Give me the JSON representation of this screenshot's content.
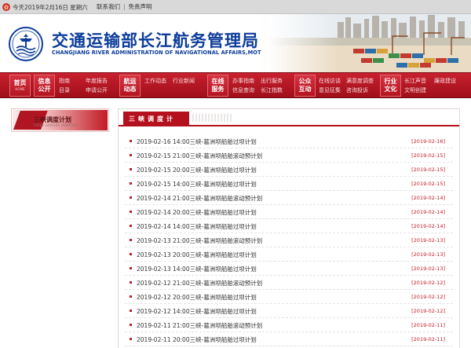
{
  "topbar": {
    "date": "今天2019年2月16日 星期六",
    "contact": "联系我们",
    "disclaimer": "免责声明"
  },
  "header": {
    "title": "交通运输部长江航务管理局",
    "subtitle": "CHANGJIANG RIVER ADMINISTRATION OF NAVIGATIONAL AFFAIRS,MOT"
  },
  "nav": {
    "home": {
      "label": "首页",
      "en": "HOME"
    },
    "groups": [
      {
        "main_line1": "信息",
        "main_line2": "公开",
        "subs": [
          "指南",
          "目录",
          "年度报告",
          "申请公开"
        ]
      },
      {
        "main_line1": "航运",
        "main_line2": "动态",
        "subs": [
          "工作动态",
          "行业新闻"
        ]
      },
      {
        "main_line1": "在线",
        "main_line2": "服务",
        "subs": [
          "办事指南",
          "信息查询",
          "出行服务",
          "长江指数"
        ]
      },
      {
        "main_line1": "公众",
        "main_line2": "互动",
        "subs": [
          "在线访谈",
          "意见征集",
          "满意度调查",
          "咨询投诉"
        ]
      },
      {
        "main_line1": "行业",
        "main_line2": "文化",
        "subs": [
          "长江声音",
          "文明创建",
          "廉政建设"
        ]
      }
    ]
  },
  "sidebar": {
    "items": [
      {
        "label": "三峡调度计划",
        "deco": "THREE GORGES DISPATCH"
      }
    ]
  },
  "panel": {
    "title": "三峡调度计",
    "items": [
      {
        "title": "2019-02-16 14:00三峡-葛洲坝船舶过坝计划",
        "date": "[2019-02-16]"
      },
      {
        "title": "2019-02-15 21:00三峡-葛洲坝船舶滚动预计划",
        "date": "[2019-02-15]"
      },
      {
        "title": "2019-02-15 20:00三峡-葛洲坝船舶过坝计划",
        "date": "[2019-02-15]"
      },
      {
        "title": "2019-02-15 14:00三峡-葛洲坝船舶过坝计划",
        "date": "[2019-02-15]"
      },
      {
        "title": "2019-02-14 21:00三峡-葛洲坝船舶滚动预计划",
        "date": "[2019-02-14]"
      },
      {
        "title": "2019-02-14 20:00三峡-葛洲坝船舶过坝计划",
        "date": "[2019-02-14]"
      },
      {
        "title": "2019-02-14 14:00三峡-葛洲坝船舶过坝计划",
        "date": "[2019-02-14]"
      },
      {
        "title": "2019-02-13 21:00三峡-葛洲坝船舶滚动预计划",
        "date": "[2019-02-13]"
      },
      {
        "title": "2019-02-13 20:00三峡-葛洲坝船舶过坝计划",
        "date": "[2019-02-13]"
      },
      {
        "title": "2019-02-13 14:00三峡-葛洲坝船舶过坝计划",
        "date": "[2019-02-13]"
      },
      {
        "title": "2019-02-12 21:00三峡-葛洲坝船舶滚动预计划",
        "date": "[2019-02-12]"
      },
      {
        "title": "2019-02-12 20:00三峡-葛洲坝船舶过坝计划",
        "date": "[2019-02-12]"
      },
      {
        "title": "2019-02-12 14:00三峡-葛洲坝船舶过坝计划",
        "date": "[2019-02-12]"
      },
      {
        "title": "2019-02-11 21:00三峡-葛洲坝船舶滚动预计划",
        "date": "[2019-02-11]"
      },
      {
        "title": "2019-02-11 20:00三峡-葛洲坝船舶过坝计划",
        "date": "[2019-02-11]"
      }
    ]
  },
  "colors": {
    "brand_red": "#b5101d",
    "brand_blue": "#0d3d9a",
    "date_red": "#c31a26"
  }
}
